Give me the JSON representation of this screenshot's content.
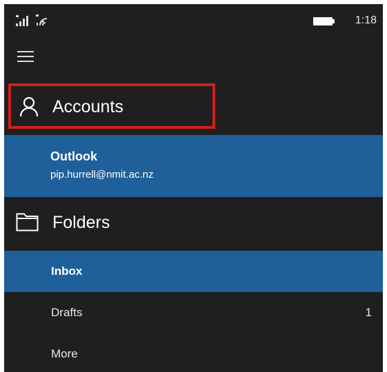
{
  "status_bar": {
    "time": "1:18",
    "icons": [
      "signal-icon",
      "wifi-icon",
      "battery-icon"
    ]
  },
  "menu": {
    "icon": "hamburger-menu-icon"
  },
  "accounts": {
    "label": "Accounts",
    "icon": "person-icon",
    "highlight_color": "#d21e1e",
    "selected_account": {
      "name": "Outlook",
      "email": "pip.hurrell@nmit.ac.nz"
    }
  },
  "folders": {
    "label": "Folders",
    "icon": "folder-icon",
    "items": [
      {
        "name": "Inbox",
        "count": "",
        "selected": true
      },
      {
        "name": "Drafts",
        "count": "1",
        "selected": false
      },
      {
        "name": "More",
        "count": "",
        "selected": false
      }
    ]
  },
  "colors": {
    "background": "#1f1f1f",
    "accent": "#1f5f9a",
    "text": "#ffffff"
  }
}
